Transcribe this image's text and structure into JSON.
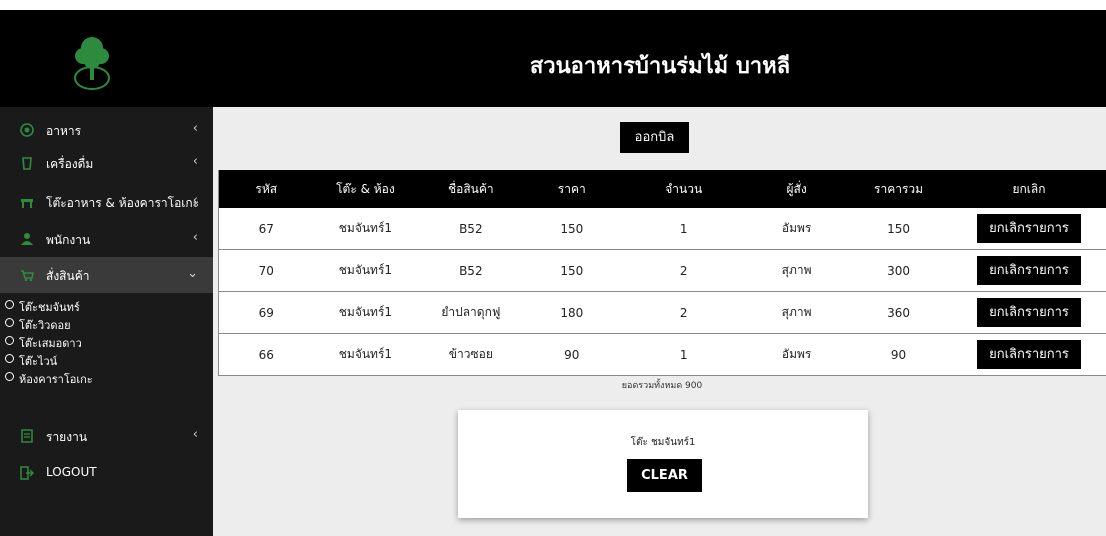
{
  "header": {
    "title": "สวนอาหารบ้านร่มไม้ บาหลี"
  },
  "colors": {
    "sidebar_bg": "#1a1a1a",
    "icon_green": "#2e8b3e",
    "accent": "#000000"
  },
  "sidebar": {
    "items": [
      {
        "label": "อาหาร",
        "icon": "food-icon",
        "chevron": "‹"
      },
      {
        "label": "เครื่องดื่ม",
        "icon": "drink-icon",
        "chevron": "‹"
      },
      {
        "label": "โต๊ะอาหาร & ห้องคาราโอเกะ",
        "icon": "table-icon",
        "chevron": "‹"
      },
      {
        "label": "พนักงาน",
        "icon": "staff-icon",
        "chevron": "‹"
      },
      {
        "label": "สั่งสินค้า",
        "icon": "order-icon",
        "chevron": "⌄"
      }
    ],
    "subitems": [
      {
        "label": "โต๊ะชมจันทร์"
      },
      {
        "label": "โต๊ะวิวดอย"
      },
      {
        "label": "โต๊ะเสมอดาว"
      },
      {
        "label": "โต๊ะไวน์"
      },
      {
        "label": "ห้องคาราโอเกะ"
      }
    ],
    "report": {
      "label": "รายงาน",
      "icon": "report-icon",
      "chevron": "‹"
    },
    "logout": {
      "label": "LOGOUT",
      "icon": "logout-icon"
    }
  },
  "main": {
    "bill_button": "ออกบิล",
    "columns": [
      "รหัส",
      "โต๊ะ & ห้อง",
      "ชื่อสินค้า",
      "ราคา",
      "จำนวน",
      "ผู้สั่ง",
      "ราคารวม",
      "ยกเลิก"
    ],
    "rows": [
      {
        "id": "67",
        "table": "ชมจันทร์1",
        "product": "B52",
        "price": "150",
        "qty": "1",
        "orderer": "อัมพร",
        "total": "150",
        "cancel": "ยกเลิกรายการ"
      },
      {
        "id": "70",
        "table": "ชมจันทร์1",
        "product": "B52",
        "price": "150",
        "qty": "2",
        "orderer": "สุภาพ",
        "total": "300",
        "cancel": "ยกเลิกรายการ"
      },
      {
        "id": "69",
        "table": "ชมจันทร์1",
        "product": "ยำปลาดุกฟู",
        "price": "180",
        "qty": "2",
        "orderer": "สุภาพ",
        "total": "360",
        "cancel": "ยกเลิกรายการ"
      },
      {
        "id": "66",
        "table": "ชมจันทร์1",
        "product": "ข้าวซอย",
        "price": "90",
        "qty": "1",
        "orderer": "อัมพร",
        "total": "90",
        "cancel": "ยกเลิกรายการ"
      }
    ],
    "total_text": "ยอดรวมทั้งหมด 900",
    "card": {
      "table_label": "โต๊ะ ชมจันทร์1",
      "clear_button": "CLEAR"
    }
  }
}
